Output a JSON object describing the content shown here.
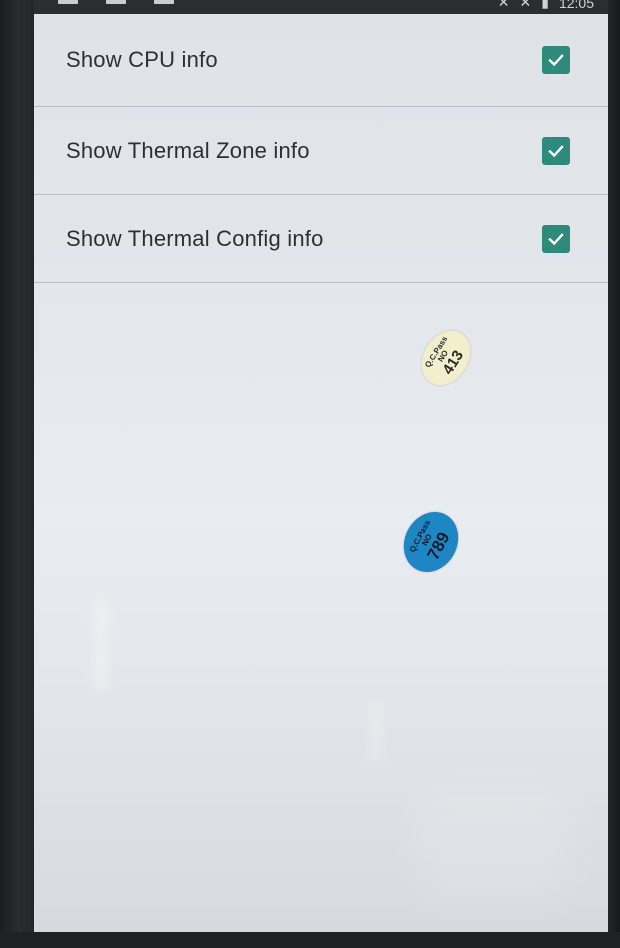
{
  "statusbar": {
    "time": "12:05",
    "icons": [
      "x-icon",
      "x-icon",
      "battery-icon"
    ]
  },
  "preferences": [
    {
      "label": "Show CPU info",
      "checked": true
    },
    {
      "label": "Show Thermal Zone info",
      "checked": true
    },
    {
      "label": "Show Thermal Config info",
      "checked": true
    }
  ],
  "stickers": [
    {
      "qc": "Q.C.Pass",
      "no_label": "NO",
      "number": "413",
      "color": "#f3efcc"
    },
    {
      "qc": "Q.C.Pass",
      "no_label": "NO",
      "number": "789",
      "color": "#1e86c4"
    }
  ],
  "colors": {
    "checkbox": "#2e8a7a",
    "screen_bg": "#e3e7ec",
    "text": "#2c2f33"
  }
}
